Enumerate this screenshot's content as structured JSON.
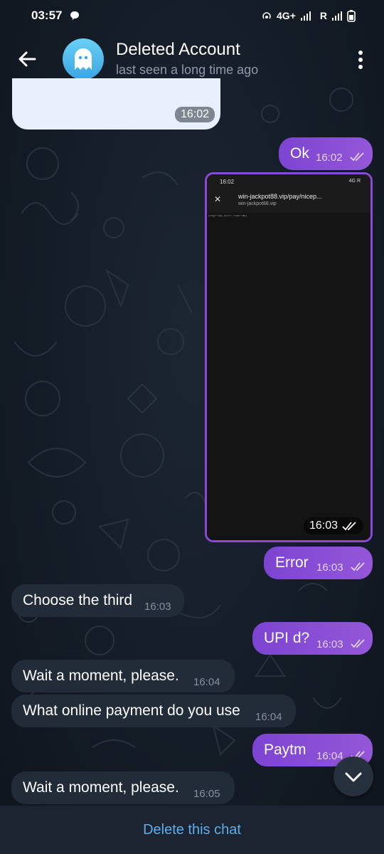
{
  "status_bar": {
    "time": "03:57",
    "network": "4G+",
    "roaming": "R"
  },
  "header": {
    "title": "Deleted Account",
    "subtitle": "last seen a long time ago",
    "icons": [
      "back-arrow-icon",
      "ghost-avatar-icon",
      "more-vertical-icon"
    ]
  },
  "messages": {
    "m0": {
      "time": "16:02"
    },
    "m1": {
      "text": "Ok",
      "time": "16:02"
    },
    "m2": {
      "time": "16:03",
      "screenshot": {
        "status_time": "16:02",
        "status_right": "4G R",
        "url": "win-jackpot88.vip/pay/nicep...",
        "domain": "win-jackpot88.vip",
        "body_text": "{\"msg\":\"pay error\",\"code\":101}"
      }
    },
    "m3": {
      "text": "Error",
      "time": "16:03"
    },
    "m4": {
      "text": "Choose the third",
      "time": "16:03"
    },
    "m5": {
      "text": "UPI d?",
      "time": "16:03"
    },
    "m6": {
      "text": "Wait a moment, please.",
      "time": "16:04"
    },
    "m7": {
      "text": "What online payment do you use",
      "time": "16:04"
    },
    "m8": {
      "text": "Paytm",
      "time": "16:04"
    },
    "m9": {
      "text": "Wait a moment, please.",
      "time": "16:05"
    }
  },
  "bottom": {
    "delete_label": "Delete this chat"
  },
  "colors": {
    "outgoing_bubble": "#8a49d6",
    "incoming_bubble": "#222c38",
    "background": "#111a25",
    "link": "#5daeef"
  }
}
